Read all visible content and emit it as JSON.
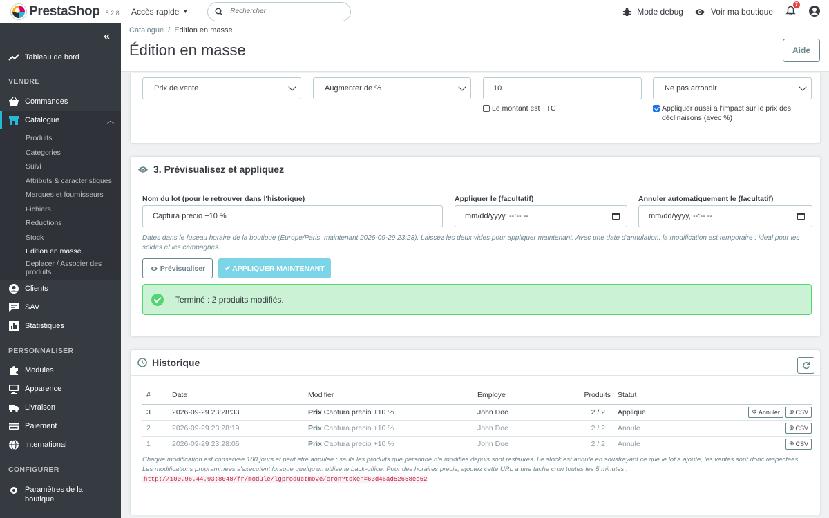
{
  "header": {
    "logo": "PrestaShop",
    "version": "8.2.8",
    "quick_access": "Accès rapide",
    "search_placeholder": "Rechercher",
    "debug": "Mode debug",
    "view_shop": "Voir ma boutique",
    "notif_count": "7"
  },
  "sidebar": {
    "dashboard": "Tableau de bord",
    "sell": "VENDRE",
    "orders": "Commandes",
    "catalog": "Catalogue",
    "catalog_items": [
      "Produits",
      "Categories",
      "Suivi",
      "Attributs & caracteristiques",
      "Marques et fournisseurs",
      "Fichiers",
      "Reductions",
      "Stock",
      "Edition en masse",
      "Deplacer / Associer des produits"
    ],
    "customers": "Clients",
    "sav": "SAV",
    "stats": "Statistiques",
    "customize": "PERSONNALISER",
    "modules": "Modules",
    "design": "Apparence",
    "shipping": "Livraison",
    "payment": "Paiement",
    "international": "International",
    "configure": "CONFIGURER",
    "shop_params": "Paramètres de la boutique"
  },
  "page": {
    "breadcrumb_parent": "Catalogue",
    "breadcrumb_current": "Edition en masse",
    "title": "Édition en masse",
    "help": "Aide"
  },
  "step2": {
    "field": "Prix de vente",
    "action": "Augmenter de %",
    "amount": "10",
    "rounding": "Ne pas arrondir",
    "ttc_label": "Le montant est TTC",
    "combos_label": "Appliquer aussi a l'impact sur le prix des déclinaisons (avec %)"
  },
  "step3": {
    "title": "3. Prévisualisez et appliquez",
    "batch_label": "Nom du lot (pour le retrouver dans l'historique)",
    "batch_value": "Captura precio +10 %",
    "apply_on_label": "Appliquer le (facultatif)",
    "apply_on_value": "mm/dd/yyyy, --:-- --",
    "undo_label": "Annuler automatiquement le (facultatif)",
    "undo_value": "mm/dd/yyyy, --:-- --",
    "help": "Dates dans le fuseau horaire de la boutique (Europe/Paris, maintenant 2026-09-29 23:28). Laissez les deux vides pour appliquer maintenant. Avec une date d'annulation, la modification est temporaire : ideal pour les soldes et les campagnes.",
    "preview_btn": "Prévisualiser",
    "apply_btn": "APPLIQUER MAINTENANT",
    "success": "Terminé : 2 produits modifiés."
  },
  "history": {
    "title": "Historique",
    "columns": [
      "#",
      "Date",
      "Modifier",
      "Employe",
      "Produits",
      "Statut"
    ],
    "rows": [
      {
        "id": "3",
        "date": "2026-09-29 23:28:33",
        "mod_bold": "Prix",
        "mod": "Captura precio +10 %",
        "employee": "John Doe",
        "products": "2 / 2",
        "status": "Applique",
        "undo": "Annuler",
        "csv": "CSV"
      },
      {
        "id": "2",
        "date": "2026-09-29 23:28:19",
        "mod_bold": "Prix",
        "mod": "Captura precio +10 %",
        "employee": "John Doe",
        "products": "2 / 2",
        "status": "Annule",
        "csv": "CSV"
      },
      {
        "id": "1",
        "date": "2026-09-29 23:28:05",
        "mod_bold": "Prix",
        "mod": "Captura precio +10 %",
        "employee": "John Doe",
        "products": "2 / 2",
        "status": "Annule",
        "csv": "CSV"
      }
    ],
    "note1": "Chaque modification est conservee 180 jours et peut etre annulee : seuls les produits que personne n'a modifies depuis sont restaures. Le stock est annule en soustrayant ce que le lot a ajoute, les ventes sont donc respectees.",
    "note2": "Les modifications programmees s'executent lorsque quelqu'un utilise le back-office. Pour des horaires precis, ajoutez cette URL a une tache cron toutes les 5 minutes :",
    "cron_url": "http://100.96.44.93:8048/fr/module/lgproductmove/cron?token=63d46ad52658ec52"
  }
}
